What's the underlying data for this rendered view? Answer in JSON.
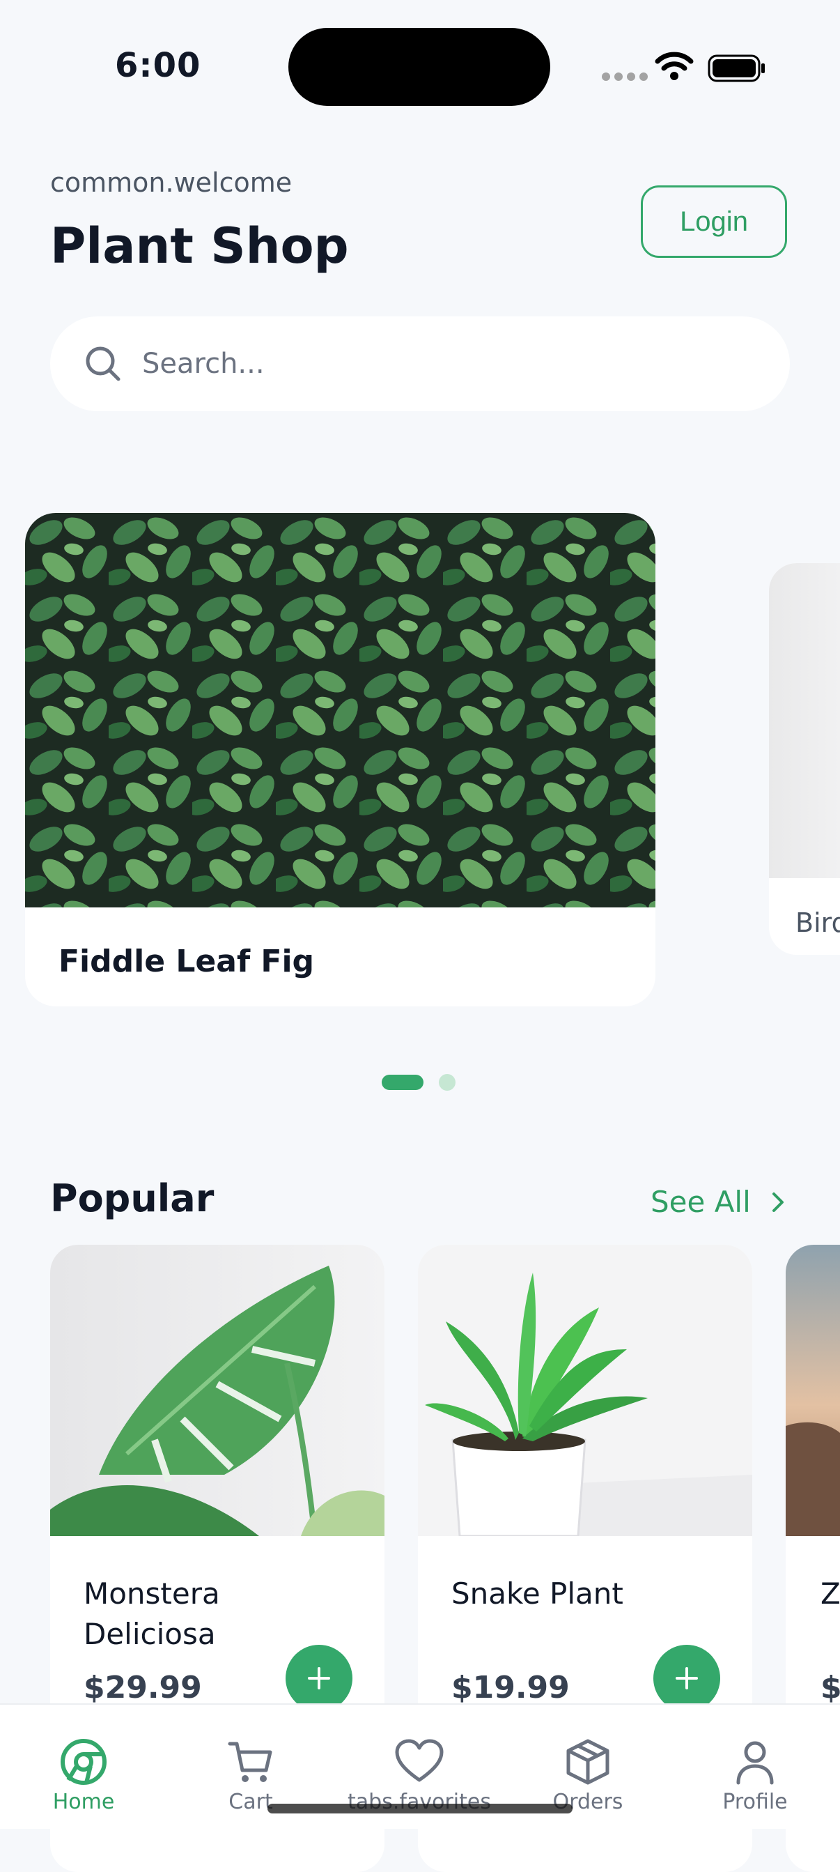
{
  "status_bar": {
    "time": "6:00"
  },
  "header": {
    "welcome": "common.welcome",
    "title": "Plant Shop",
    "login_label": "Login"
  },
  "search": {
    "placeholder": "Search..."
  },
  "featured": {
    "items": [
      {
        "name": "Fiddle Leaf Fig"
      },
      {
        "name": "Bird"
      }
    ],
    "page_count": 2,
    "active_page": 1
  },
  "popular": {
    "heading": "Popular",
    "see_all_label": "See All",
    "items": [
      {
        "name": "Monstera Deliciosa",
        "price": "$29.99"
      },
      {
        "name": "Snake Plant",
        "price": "$19.99"
      },
      {
        "name": "ZZ",
        "price": "$"
      }
    ]
  },
  "tabs": [
    {
      "label": "Home",
      "icon": "home-icon",
      "active": true
    },
    {
      "label": "Cart",
      "icon": "cart-icon",
      "active": false
    },
    {
      "label": "tabs.favorites",
      "icon": "heart-icon",
      "active": false
    },
    {
      "label": "Orders",
      "icon": "box-icon",
      "active": false
    },
    {
      "label": "Profile",
      "icon": "person-icon",
      "active": false
    }
  ],
  "colors": {
    "accent": "#34a86b",
    "background": "#f6f8fb",
    "text": "#111827"
  }
}
